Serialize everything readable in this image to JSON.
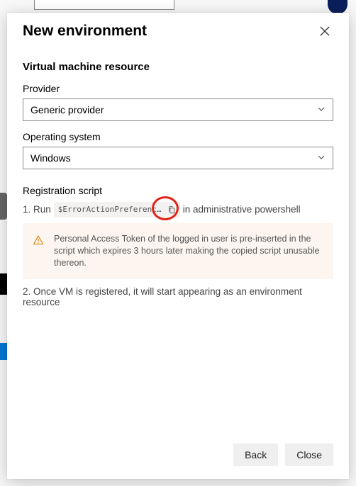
{
  "modal": {
    "title": "New environment",
    "section_heading": "Virtual machine resource",
    "provider": {
      "label": "Provider",
      "value": "Generic provider"
    },
    "os": {
      "label": "Operating system",
      "value": "Windows"
    },
    "registration": {
      "heading": "Registration script",
      "step1_prefix": "1. Run",
      "step1_code": "$ErrorActionPreference=\"Stop…",
      "step1_suffix": "in administrative powershell",
      "info": "Personal Access Token of the logged in user is pre-inserted in the script which expires 3 hours later making the copied script unusable thereon.",
      "step2": "2. Once VM is registered, it will start appearing as an environment resource"
    },
    "footer": {
      "back": "Back",
      "close": "Close"
    }
  }
}
